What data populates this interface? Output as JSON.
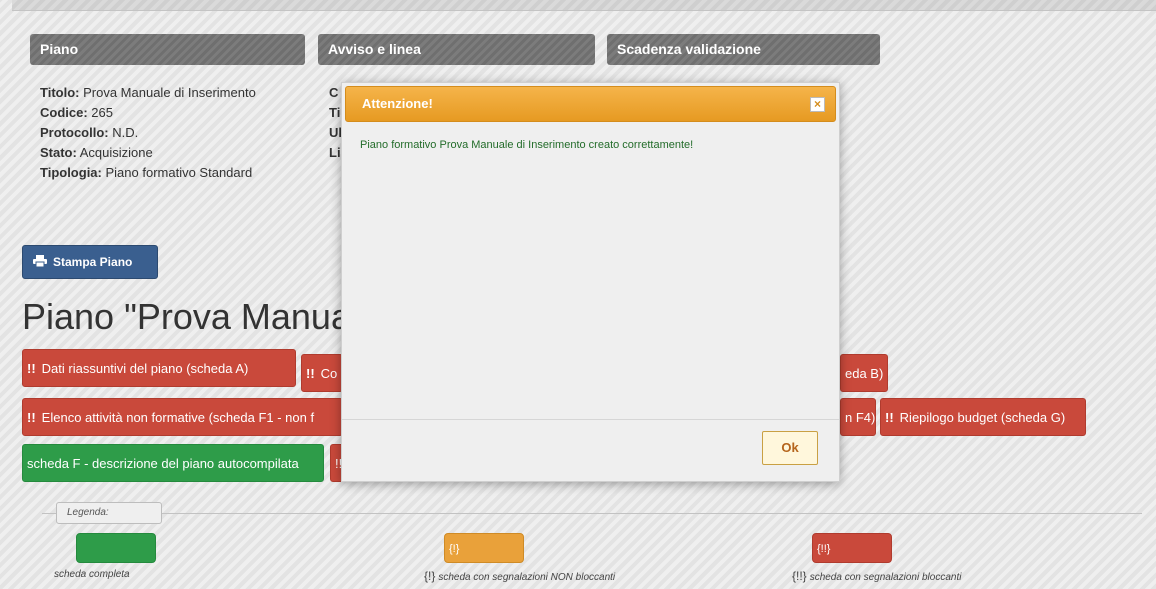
{
  "headers": {
    "piano": "Piano",
    "avviso": "Avviso e linea",
    "scadenza": "Scadenza validazione"
  },
  "info": [
    {
      "label": "Titolo:",
      "value": "Prova Manuale di Inserimento"
    },
    {
      "label": "Codice:",
      "value": "265"
    },
    {
      "label": "Protocollo:",
      "value": "N.D."
    },
    {
      "label": "Stato:",
      "value": "Acquisizione"
    },
    {
      "label": "Tipologia:",
      "value": "Piano formativo Standard"
    }
  ],
  "avviso_partial": [
    "C",
    "Ti",
    "Ul",
    "Li"
  ],
  "print_button": {
    "label": "Stampa Piano",
    "icon": "printer-icon"
  },
  "page_heading": "Piano \"Prova Manua",
  "tags": {
    "dati": {
      "mark": "!!",
      "label": "Dati riassuntivi del piano (scheda A)"
    },
    "co": {
      "mark": "!!",
      "label": "Co"
    },
    "schedab": {
      "label": "eda B)"
    },
    "elenco": {
      "mark": "!!",
      "label": "Elenco attività non formative (scheda F1 - non f"
    },
    "f4": {
      "label": "n F4)"
    },
    "budget": {
      "mark": "!!",
      "label": "Riepilogo budget (scheda G)"
    },
    "schedaf": {
      "label": "scheda F - descrizione del piano autocompilata"
    },
    "red_partial": {
      "label": "!!"
    }
  },
  "legend": {
    "title": "Legenda:",
    "items": [
      {
        "swatch": "",
        "label": "scheda completa"
      },
      {
        "swatch": "{!}",
        "symbol": "{!}",
        "label": "scheda con segnalazioni NON bloccanti"
      },
      {
        "swatch": "{!!}",
        "symbol": "{!!}",
        "label": "scheda con segnalazioni bloccanti"
      }
    ]
  },
  "modal": {
    "title": "Attenzione!",
    "close_symbol": "×",
    "message": "Piano formativo Prova Manuale di Inserimento creato correttamente!",
    "ok_label": "Ok"
  },
  "colors": {
    "header_gray": "#737373",
    "red": "#c9493b",
    "green": "#2e9c49",
    "orange": "#e9a13a",
    "blue_button": "#3a5f8f"
  }
}
